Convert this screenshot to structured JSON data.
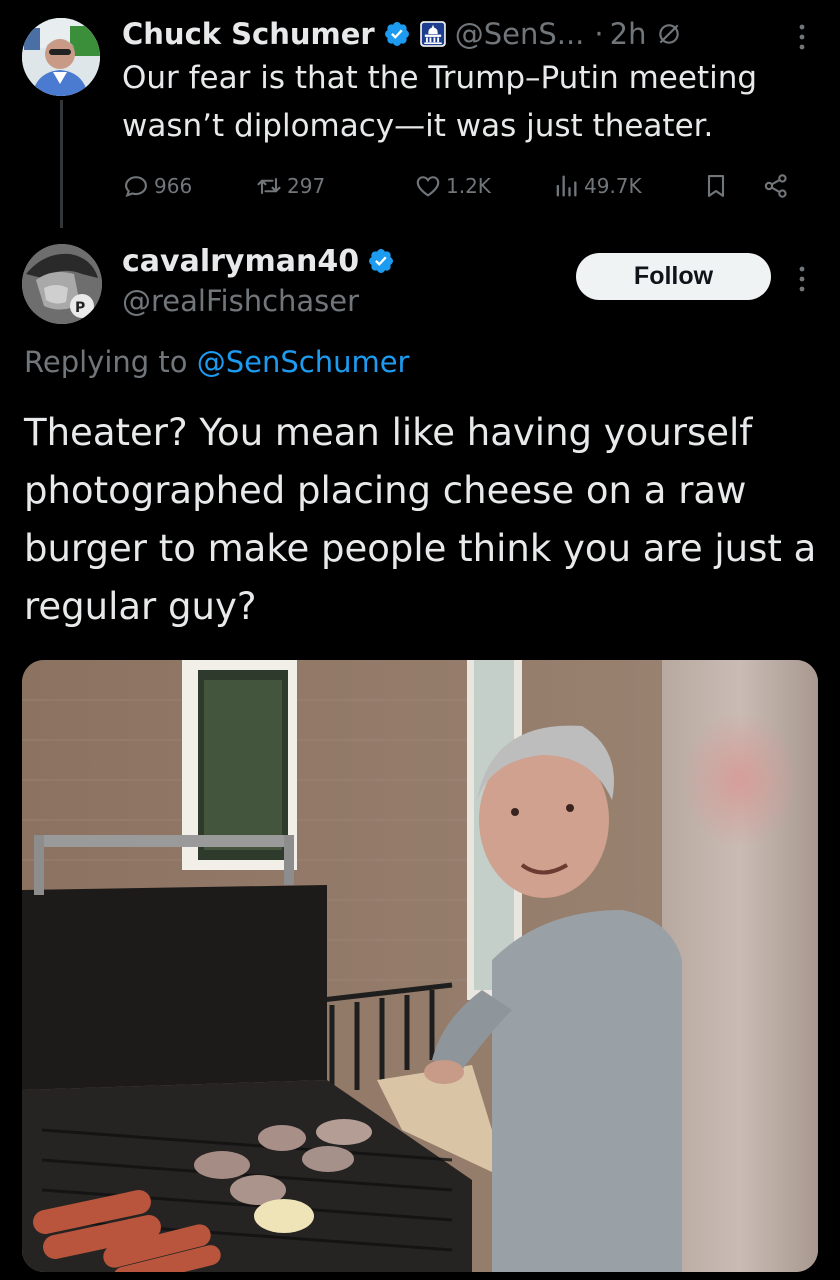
{
  "parent_tweet": {
    "author_name": "Chuck Schumer",
    "author_handle": "@SenS...",
    "separator": "·",
    "time": "2h",
    "text": "Our fear is that the Trump–Putin meeting wasn’t diplomacy—it was just theater.",
    "stats": {
      "replies": "966",
      "reposts": "297",
      "likes": "1.2K",
      "views": "49.7K"
    },
    "icons": {
      "verified": "verified-badge-icon",
      "affiliation": "capitol-icon",
      "muted": "muted-icon",
      "more": "more-vertical-icon"
    }
  },
  "reply_tweet": {
    "author_name": "cavalryman40",
    "author_handle": "@realFishchaser",
    "follow_label": "Follow",
    "replying_prefix": "Replying to",
    "replying_to": "@SenSchumer",
    "text": "Theater? You mean like having yourself photographed placing cheese on a raw burger to make people think you are just a regular guy?"
  },
  "colors": {
    "background": "#000000",
    "text_primary": "#e7e9ea",
    "text_secondary": "#71767b",
    "accent_blue": "#1d9bf0",
    "verified_blue": "#1d9bf0",
    "follow_button_bg": "#eff3f4"
  }
}
